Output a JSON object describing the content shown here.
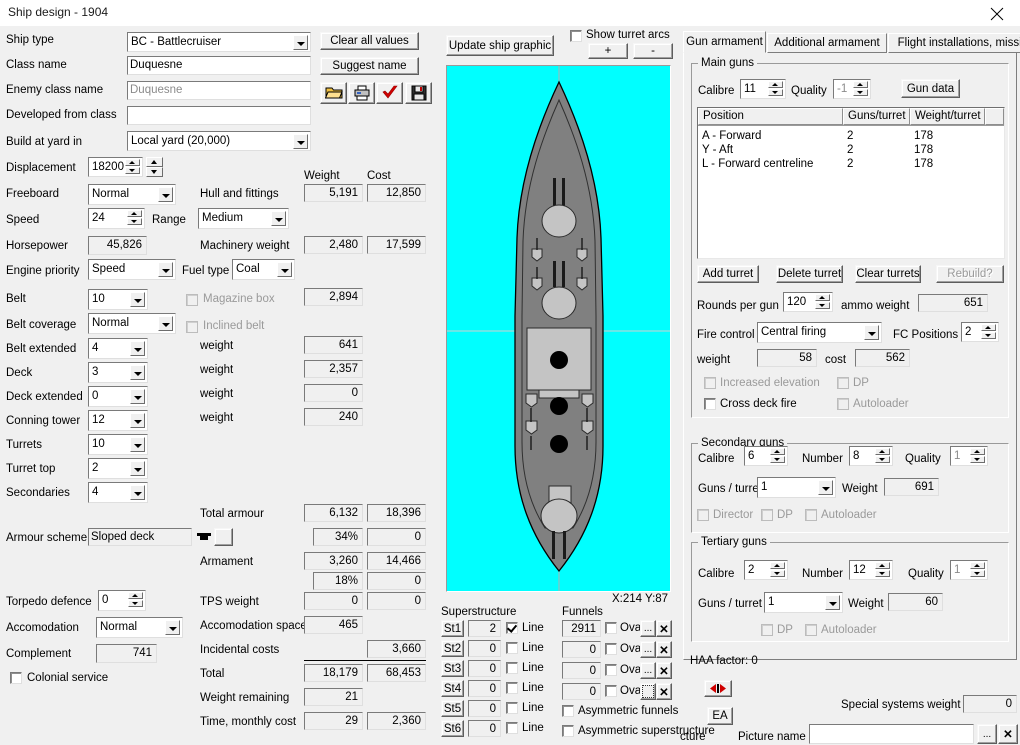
{
  "window": {
    "title": "Ship design - 1904",
    "close_icon": "close-icon"
  },
  "left": {
    "labels": {
      "ship_type": "Ship type",
      "class_name": "Class name",
      "enemy_class_name": "Enemy class name",
      "developed_from_class": "Developed from class",
      "build_at_yard_in": "Build at yard in",
      "displacement": "Displacement",
      "freeboard": "Freeboard",
      "speed": "Speed",
      "range": "Range",
      "horsepower": "Horsepower",
      "engine_priority": "Engine priority",
      "fuel_type": "Fuel type",
      "belt": "Belt",
      "belt_coverage": "Belt coverage",
      "belt_extended": "Belt extended",
      "deck": "Deck",
      "deck_extended": "Deck extended",
      "conning_tower": "Conning tower",
      "turrets": "Turrets",
      "turret_top": "Turret top",
      "secondaries": "Secondaries",
      "armour_scheme": "Armour scheme",
      "torpedo_defence": "Torpedo defence",
      "accomodation": "Accomodation",
      "complement": "Complement",
      "colonial_service": "Colonial service",
      "magazine_box": "Magazine box",
      "inclined_belt": "Inclined belt",
      "weight": "weight"
    },
    "values": {
      "ship_type": "BC - Battlecruiser",
      "class_name": "Duquesne",
      "enemy_class_name": "Duquesne",
      "developed_from_class": "",
      "build_at_yard_in": "Local yard (20,000)",
      "displacement": "18200",
      "freeboard": "Normal",
      "speed": "24",
      "range": "Medium",
      "horsepower": "45,826",
      "engine_priority": "Speed",
      "fuel_type": "Coal",
      "belt": "10",
      "belt_coverage": "Normal",
      "belt_extended": "4",
      "deck": "3",
      "deck_extended": "0",
      "conning_tower": "12",
      "turrets": "10",
      "turret_top": "2",
      "secondaries": "4",
      "armour_scheme": "Sloped deck",
      "torpedo_defence": "0",
      "accomodation": "Normal",
      "complement": "741",
      "colonial_service_checked": false,
      "magazine_box_checked": false,
      "inclined_belt_checked": false
    }
  },
  "weights": {
    "col_weight": "Weight",
    "col_cost": "Cost",
    "rows": [
      {
        "label": "Hull and fittings",
        "weight": "5,191",
        "cost": "12,850"
      },
      {
        "label": "Machinery weight",
        "weight": "2,480",
        "cost": "17,599"
      },
      {
        "label": "",
        "weight": "2,894",
        "cost": ""
      },
      {
        "label": "weight",
        "weight": "641",
        "cost": ""
      },
      {
        "label": "weight",
        "weight": "2,357",
        "cost": ""
      },
      {
        "label": "weight",
        "weight": "0",
        "cost": ""
      },
      {
        "label": "weight",
        "weight": "240",
        "cost": ""
      }
    ],
    "totals": [
      {
        "label": "Total armour",
        "weight": "6,132",
        "cost": "18,396"
      },
      {
        "label": "",
        "weight": "34%",
        "cost": "0"
      },
      {
        "label": "Armament",
        "weight": "3,260",
        "cost": "14,466"
      },
      {
        "label": "",
        "weight": "18%",
        "cost": "0"
      },
      {
        "label": "TPS weight",
        "weight": "0",
        "cost": "0"
      },
      {
        "label": "Accomodation space",
        "weight": "465",
        "cost": ""
      },
      {
        "label": "Incidental costs",
        "weight": "",
        "cost": "3,660"
      },
      {
        "label": "Total",
        "weight": "18,179",
        "cost": "68,453"
      },
      {
        "label": "Weight remaining",
        "weight": "21",
        "cost": ""
      },
      {
        "label": "Time, monthly cost",
        "weight": "29",
        "cost": "2,360"
      }
    ]
  },
  "center": {
    "clear_all_values": "Clear all values",
    "suggest_name": "Suggest name",
    "icons": [
      {
        "name": "open-folder-icon"
      },
      {
        "name": "print-icon"
      },
      {
        "name": "check-icon"
      },
      {
        "name": "save-disk-icon"
      }
    ],
    "update_ship_graphic": "Update ship graphic",
    "show_turret_arcs": "Show turret arcs",
    "show_turret_arcs_checked": false,
    "zoom_in": "+",
    "zoom_out": "-",
    "coords": "X:214 Y:87"
  },
  "superstructure": {
    "title": "Superstructure",
    "line_label": "Line",
    "rows": [
      {
        "button": "St1",
        "value": "2",
        "line_checked": true
      },
      {
        "button": "St2",
        "value": "0",
        "line_checked": false
      },
      {
        "button": "St3",
        "value": "0",
        "line_checked": false
      },
      {
        "button": "St4",
        "value": "0",
        "line_checked": false
      },
      {
        "button": "St5",
        "value": "0",
        "line_checked": false
      },
      {
        "button": "St6",
        "value": "0",
        "line_checked": false
      }
    ]
  },
  "funnels": {
    "title": "Funnels",
    "oval_label": "Oval",
    "browse_label": "...",
    "clear_label": "✕",
    "rows": [
      {
        "value": "2911",
        "oval_checked": false
      },
      {
        "value": "0",
        "oval_checked": false
      },
      {
        "value": "0",
        "oval_checked": false
      },
      {
        "value": "0",
        "oval_checked": false
      }
    ],
    "asymmetric_funnels": "Asymmetric funnels",
    "asymmetric_funnels_checked": false,
    "asymmetric_superstructure": "Asymmetric superstructure",
    "asymmetric_superstructure_checked": false
  },
  "tabs": [
    {
      "label": "Gun armament",
      "selected": true
    },
    {
      "label": "Additional armament",
      "selected": false
    },
    {
      "label": "Flight installations, missiles",
      "selected": false
    }
  ],
  "main_guns": {
    "title": "Main guns",
    "calibre_label": "Calibre",
    "calibre": "11",
    "quality_label": "Quality",
    "quality": "-1",
    "gun_data_button": "Gun data",
    "columns": [
      "Position",
      "Guns/turret",
      "Weight/turret",
      ""
    ],
    "rows": [
      {
        "position": "A - Forward",
        "guns": "2",
        "weight": "178"
      },
      {
        "position": "Y - Aft",
        "guns": "2",
        "weight": "178"
      },
      {
        "position": "L - Forward centreline",
        "guns": "2",
        "weight": "178"
      }
    ],
    "add_turret": "Add turret",
    "delete_turret": "Delete turret",
    "clear_turrets": "Clear turrets",
    "rebuild": "Rebuild?",
    "rounds_per_gun_label": "Rounds per gun",
    "rounds_per_gun": "120",
    "ammo_weight_label": "ammo weight",
    "ammo_weight": "651",
    "fire_control_label": "Fire control",
    "fire_control": "Central firing",
    "fc_positions_label": "FC Positions",
    "fc_positions": "2",
    "weight_label": "weight",
    "weight": "58",
    "cost_label": "cost",
    "cost": "562",
    "increased_elevation": "Increased elevation",
    "increased_elevation_checked": false,
    "dp": "DP",
    "dp_checked": false,
    "cross_deck_fire": "Cross deck fire",
    "cross_deck_fire_checked": false,
    "autoloader": "Autoloader",
    "autoloader_checked": false
  },
  "secondary_guns": {
    "title": "Secondary guns",
    "calibre_label": "Calibre",
    "calibre": "6",
    "number_label": "Number",
    "number": "8",
    "quality_label": "Quality",
    "quality": "1",
    "guns_per_turret_label": "Guns / turret",
    "guns_per_turret": "1",
    "weight_label": "Weight",
    "weight": "691",
    "director": "Director",
    "director_checked": false,
    "dp": "DP",
    "dp_checked": false,
    "autoloader": "Autoloader",
    "autoloader_checked": false
  },
  "tertiary_guns": {
    "title": "Tertiary guns",
    "calibre_label": "Calibre",
    "calibre": "2",
    "number_label": "Number",
    "number": "12",
    "quality_label": "Quality",
    "quality": "1",
    "guns_per_turret_label": "Guns / turret",
    "guns_per_turret": "1",
    "weight_label": "Weight",
    "weight": "60",
    "dp": "DP",
    "dp_checked": false,
    "autoloader": "Autoloader",
    "autoloader_checked": false
  },
  "haa_factor": "HAA factor: 0",
  "bottom": {
    "flip_button": "flip-arrows-icon",
    "ea_button": "EA",
    "special_systems_weight_label": "Special systems weight",
    "special_systems_weight": "0",
    "picture_name_label": "Picture name",
    "picture_name": "",
    "browse": "...",
    "clear": "✕",
    "picture_partial_label": "cture"
  },
  "colors": {
    "canvas": "#00ffff",
    "hull": "#808080",
    "deck_light": "#c0c0c0",
    "face": "#f0f0f0"
  }
}
